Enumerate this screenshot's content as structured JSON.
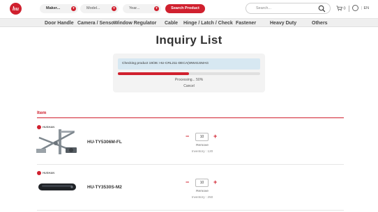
{
  "header": {
    "logo_text": "hu",
    "maker_label": "Maker...",
    "model_label": "Model...",
    "year_label": "Year...",
    "search_button": "Search Product",
    "search_placeholder": "Search...",
    "cart_count": "0",
    "language": "EN"
  },
  "categories": [
    "Door Handle",
    "Camera / Senso",
    "Window Regulator",
    "Cable",
    "Hinge / Latch / Check",
    "Fastener",
    "Heavy Duty",
    "Others"
  ],
  "page_title": "Inquiry List",
  "processing": {
    "checking_text": "Checking product 19/36: HU-CRL211-DECA(WW41SMAG",
    "progress_percent": 50,
    "status_text": "Processing... 50%",
    "cancel_label": "Cancel"
  },
  "items_header": "Item",
  "items": [
    {
      "brand": "HUSHAN",
      "sku": "HU-TY5306M-FL",
      "quantity": "10",
      "remove_label": "Remove",
      "inventory": "Inventory : 120"
    },
    {
      "brand": "HUSHAN",
      "sku": "HU-TY3530S-M2",
      "quantity": "10",
      "remove_label": "Remove",
      "inventory": "Inventory : 250"
    }
  ],
  "colors": {
    "accent": "#d0202e",
    "nav_bg": "#efefef",
    "checking_bg": "#d7e8f2"
  }
}
